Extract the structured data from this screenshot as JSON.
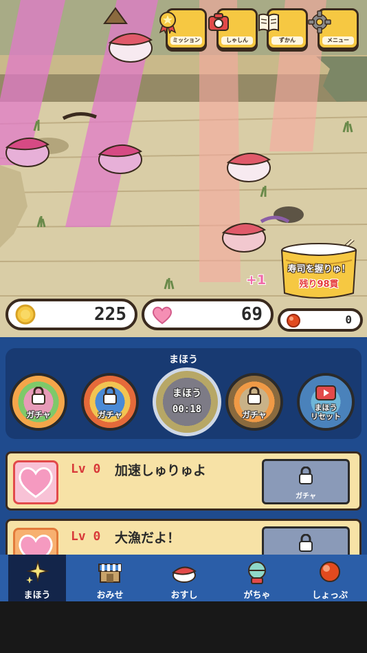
{
  "top_buttons": [
    {
      "label": "ミッション",
      "icon": "medal-icon"
    },
    {
      "label": "しゃしん",
      "icon": "camera-icon"
    },
    {
      "label": "ずかん",
      "icon": "book-icon"
    },
    {
      "label": "メニュー",
      "icon": "gear-icon"
    }
  ],
  "bucket": {
    "title": "寿司を握りゅ！",
    "remaining": "残り98貫"
  },
  "floating_text": "+1",
  "counters": {
    "coins": "225",
    "hearts": "69",
    "orbs": "0"
  },
  "magic": {
    "title": "まほう",
    "slots": [
      {
        "caption": "ガチャ",
        "locked": true
      },
      {
        "caption": "ガチャ",
        "locked": true
      },
      {
        "caption": "まほう",
        "timer": "00:18",
        "active": true
      },
      {
        "caption": "ガチャ",
        "locked": true
      },
      {
        "caption": "まほう\nリセット",
        "locked": false
      }
    ]
  },
  "upgrades": [
    {
      "level": "Lv 0",
      "name": "加速しゅりゅよ",
      "button": "ガチャ"
    },
    {
      "level": "Lv 0",
      "name": "大漁だよ！",
      "button": ""
    }
  ],
  "tabs": [
    {
      "label": "まほう",
      "icon": "sparkle-icon",
      "active": true
    },
    {
      "label": "おみせ",
      "icon": "shop-icon",
      "active": false
    },
    {
      "label": "おすし",
      "icon": "sushi-icon",
      "active": false
    },
    {
      "label": "がちゃ",
      "icon": "gacha-capsule-icon",
      "active": false
    },
    {
      "label": "しょっぷ",
      "icon": "orb-icon",
      "active": false
    }
  ],
  "colors": {
    "accent_gold": "#f6c842",
    "panel_blue": "#1f4b8e",
    "tab_blue": "#2b5ea8",
    "pink_beam": "#e07ac8",
    "salmon_beam": "#f6a9a0"
  }
}
